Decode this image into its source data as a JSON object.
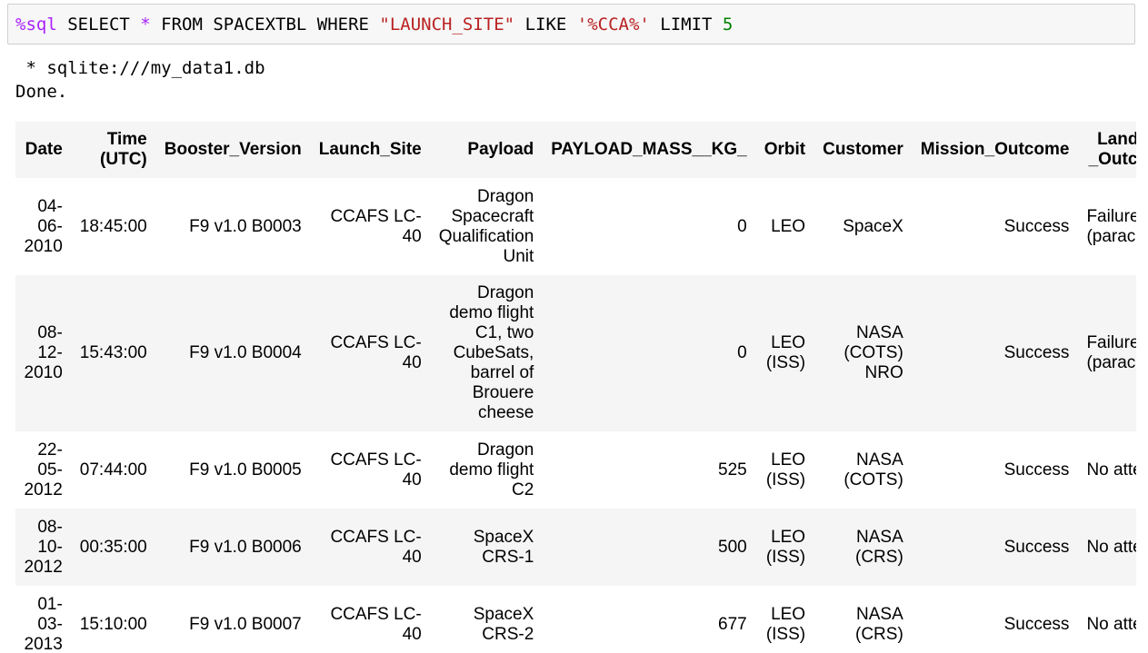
{
  "input": {
    "magic": "%sql",
    "part1": " SELECT ",
    "star": "*",
    "part2": " FROM SPACEXTBL WHERE ",
    "col": "\"LAUNCH_SITE\"",
    "part3": " LIKE ",
    "pattern": "'%CCA%'",
    "part4": " LIMIT ",
    "limit": "5"
  },
  "output": {
    "line1": " * sqlite:///my_data1.db",
    "line2": "Done."
  },
  "table": {
    "headers": [
      "Date",
      "Time (UTC)",
      "Booster_Version",
      "Launch_Site",
      "Payload",
      "PAYLOAD_MASS__KG_",
      "Orbit",
      "Customer",
      "Mission_Outcome",
      "Landing _Outcome"
    ],
    "rows": [
      [
        "04-06-2010",
        "18:45:00",
        "F9 v1.0 B0003",
        "CCAFS LC-40",
        "Dragon Spacecraft Qualification Unit",
        "0",
        "LEO",
        "SpaceX",
        "Success",
        "Failure (parachute)"
      ],
      [
        "08-12-2010",
        "15:43:00",
        "F9 v1.0 B0004",
        "CCAFS LC-40",
        "Dragon demo flight C1, two CubeSats, barrel of Brouere cheese",
        "0",
        "LEO (ISS)",
        "NASA (COTS) NRO",
        "Success",
        "Failure (parachute)"
      ],
      [
        "22-05-2012",
        "07:44:00",
        "F9 v1.0 B0005",
        "CCAFS LC-40",
        "Dragon demo flight C2",
        "525",
        "LEO (ISS)",
        "NASA (COTS)",
        "Success",
        "No attempt"
      ],
      [
        "08-10-2012",
        "00:35:00",
        "F9 v1.0 B0006",
        "CCAFS LC-40",
        "SpaceX CRS-1",
        "500",
        "LEO (ISS)",
        "NASA (CRS)",
        "Success",
        "No attempt"
      ],
      [
        "01-03-2013",
        "15:10:00",
        "F9 v1.0 B0007",
        "CCAFS LC-40",
        "SpaceX CRS-2",
        "677",
        "LEO (ISS)",
        "NASA (CRS)",
        "Success",
        "No attempt"
      ]
    ]
  }
}
